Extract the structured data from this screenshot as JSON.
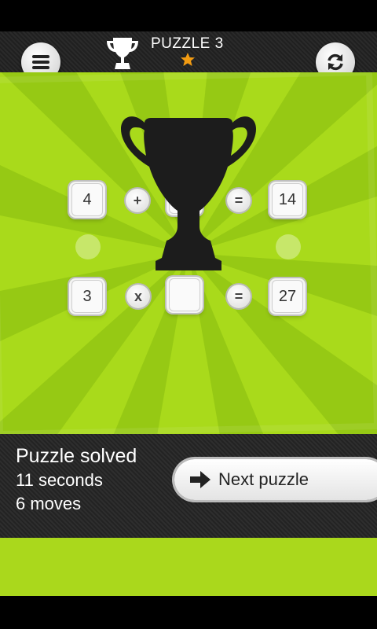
{
  "header": {
    "title": "PUZZLE 3",
    "stars": 1,
    "menu_icon": "hamburger-menu-icon",
    "refresh_icon": "refresh-icon"
  },
  "board": {
    "top_row": {
      "left": "4",
      "right": "14"
    },
    "bottom_row": {
      "left": "3",
      "operator": "x",
      "equals": "=",
      "right": "27"
    }
  },
  "result": {
    "title": "Puzzle solved",
    "time": "11 seconds",
    "moves": "6 moves"
  },
  "next_button": {
    "label": "Next puzzle"
  },
  "colors": {
    "green": "#a9da1b",
    "ray_green": "#96c914",
    "dark_bar": "#262626",
    "star": "#f39c12"
  }
}
